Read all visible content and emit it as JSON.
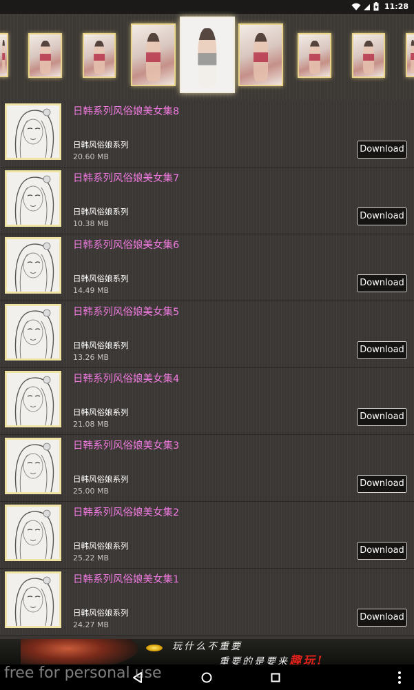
{
  "status_bar": {
    "time": "11:28",
    "icons": [
      "wifi-icon",
      "signal-icon",
      "battery-icon"
    ]
  },
  "gallery": {
    "thumbnails": [
      {
        "name": "gallery-thumb-1",
        "selected": false
      },
      {
        "name": "gallery-thumb-2",
        "selected": false
      },
      {
        "name": "gallery-thumb-3",
        "selected": false
      },
      {
        "name": "gallery-thumb-4",
        "selected": false
      },
      {
        "name": "gallery-thumb-5",
        "selected": true
      },
      {
        "name": "gallery-thumb-6",
        "selected": false
      },
      {
        "name": "gallery-thumb-7",
        "selected": false
      },
      {
        "name": "gallery-thumb-8",
        "selected": false
      },
      {
        "name": "gallery-thumb-9",
        "selected": false
      }
    ]
  },
  "list": {
    "items": [
      {
        "title": "日韩系列风俗娘美女集8",
        "subtitle": "日韩风俗娘系列",
        "size": "20.60 MB",
        "button": "Download"
      },
      {
        "title": "日韩系列风俗娘美女集7",
        "subtitle": "日韩风俗娘系列",
        "size": "10.38 MB",
        "button": "Download"
      },
      {
        "title": "日韩系列风俗娘美女集6",
        "subtitle": "日韩风俗娘系列",
        "size": "14.49 MB",
        "button": "Download"
      },
      {
        "title": "日韩系列风俗娘美女集5",
        "subtitle": "日韩风俗娘系列",
        "size": "13.26 MB",
        "button": "Download"
      },
      {
        "title": "日韩系列风俗娘美女集4",
        "subtitle": "日韩风俗娘系列",
        "size": "21.08 MB",
        "button": "Download"
      },
      {
        "title": "日韩系列风俗娘美女集3",
        "subtitle": "日韩风俗娘系列",
        "size": "25.00 MB",
        "button": "Download"
      },
      {
        "title": "日韩系列风俗娘美女集2",
        "subtitle": "日韩风俗娘系列",
        "size": "25.22 MB",
        "button": "Download"
      },
      {
        "title": "日韩系列风俗娘美女集1",
        "subtitle": "日韩风俗娘系列",
        "size": "24.27 MB",
        "button": "Download"
      }
    ]
  },
  "ad_banner": {
    "line1": "玩什么不重要",
    "line2_prefix": "重要的是要来",
    "line2_highlight": "趣玩",
    "line2_suffix": "!"
  },
  "watermark": "free for personal use",
  "navbar": {
    "buttons": [
      "back-icon",
      "home-icon",
      "recents-icon",
      "overflow-menu-icon"
    ]
  },
  "colors": {
    "title_pink": "#f07be0",
    "thumb_border_gold": "#e9d48a",
    "background": "#3b3734",
    "ad_highlight": "#e0221a"
  }
}
